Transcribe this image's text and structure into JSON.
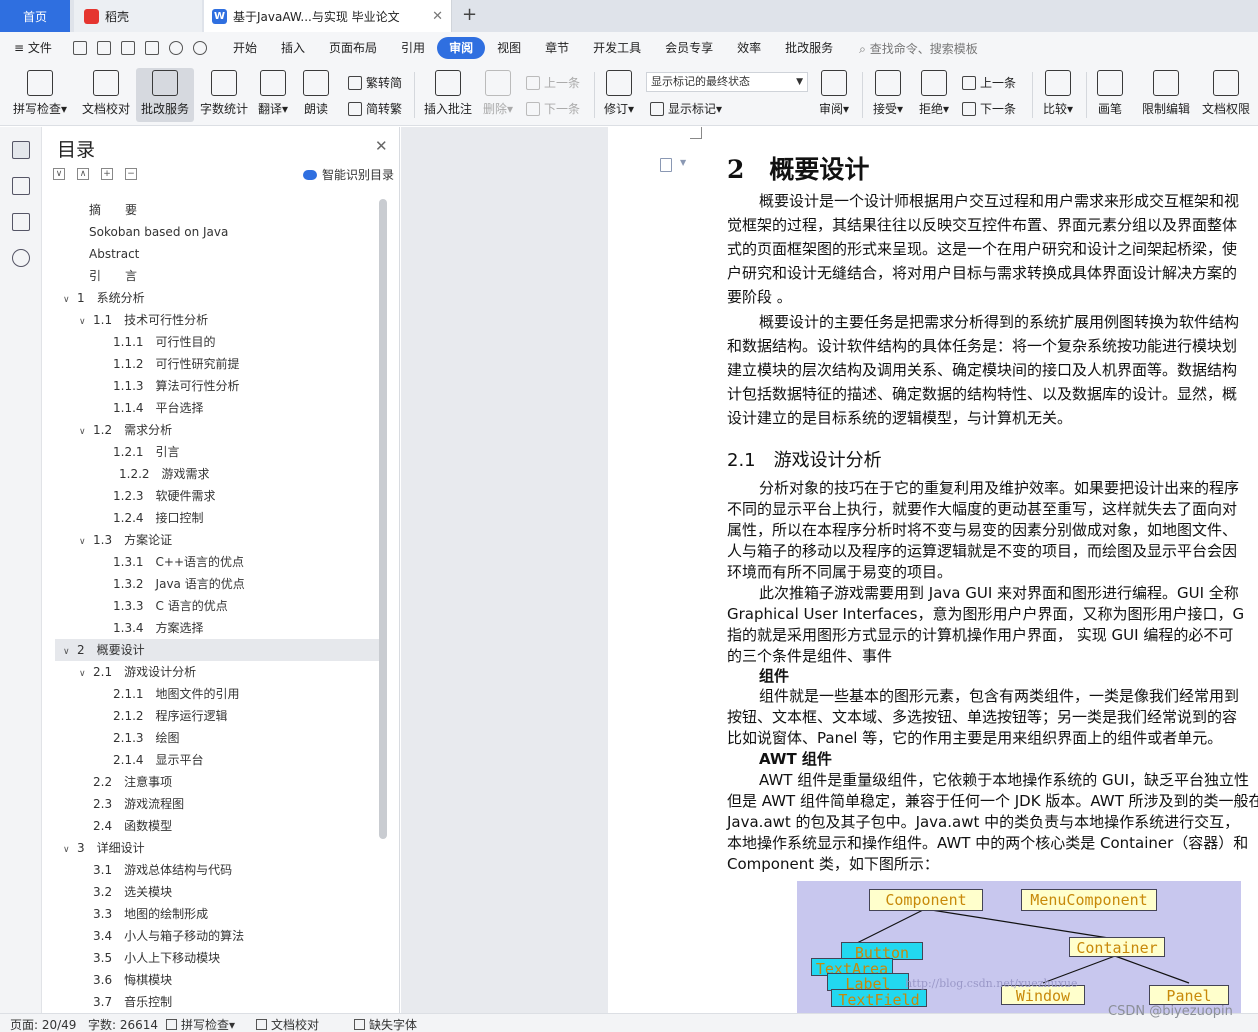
{
  "tabs": {
    "home": "首页",
    "daoke": "稻壳",
    "doc": "基于JavaAW...与实现 毕业论文",
    "doc_close": "✕",
    "add": "+"
  },
  "menu": {
    "file": "≡ 文件",
    "items": [
      "开始",
      "插入",
      "页面布局",
      "引用",
      "审阅",
      "视图",
      "章节",
      "开发工具",
      "会员专享",
      "效率",
      "批改服务"
    ],
    "active": "审阅",
    "search": "查找命令、搜索模板"
  },
  "ribbon": {
    "spell_check": "拼写检查",
    "doc_proof": "文档校对",
    "grading": "批改服务",
    "word_count": "字数统计",
    "translate": "翻译",
    "read_aloud": "朗读",
    "trad_to_simp": "繁转简",
    "simp_to_trad": "简转繁",
    "insert_comment": "插入批注",
    "delete": "删除",
    "prev1": "上一条",
    "next1": "下一条",
    "revise": "修订",
    "markup_select": "显示标记的最终状态",
    "show_markup": "显示标记",
    "review": "审阅",
    "accept": "接受",
    "reject": "拒绝",
    "prev2": "上一条",
    "next2": "下一条",
    "compare": "比较",
    "pen": "画笔",
    "restrict_edit": "限制编辑",
    "doc_permission": "文档权限"
  },
  "toc": {
    "title": "目录",
    "close": "✕",
    "smart": "智能识别目录",
    "items": [
      {
        "level": 0,
        "num": "",
        "text": "摘　　要",
        "arrow": ""
      },
      {
        "level": 0,
        "num": "",
        "text": "Sokoban based on Java",
        "arrow": ""
      },
      {
        "level": 0,
        "num": "",
        "text": "Abstract",
        "arrow": ""
      },
      {
        "level": 0,
        "num": "",
        "text": "引　　言",
        "arrow": ""
      },
      {
        "level": 0,
        "num": "1",
        "text": "系统分析",
        "arrow": "∨"
      },
      {
        "level": 1,
        "num": "1.1",
        "text": "技术可行性分析",
        "arrow": "∨"
      },
      {
        "level": 2,
        "num": "1.1.1",
        "text": "可行性目的",
        "arrow": ""
      },
      {
        "level": 2,
        "num": "1.1.2",
        "text": "可行性研究前提",
        "arrow": ""
      },
      {
        "level": 2,
        "num": "1.1.3",
        "text": "算法可行性分析",
        "arrow": ""
      },
      {
        "level": 2,
        "num": "1.1.4",
        "text": "平台选择",
        "arrow": ""
      },
      {
        "level": 1,
        "num": "1.2",
        "text": "需求分析",
        "arrow": "∨"
      },
      {
        "level": 2,
        "num": "1.2.1",
        "text": "引言",
        "arrow": ""
      },
      {
        "level": 3,
        "num": "1.2.2",
        "text": "游戏需求",
        "arrow": ""
      },
      {
        "level": 2,
        "num": "1.2.3",
        "text": "软硬件需求",
        "arrow": ""
      },
      {
        "level": 2,
        "num": "1.2.4",
        "text": "接口控制",
        "arrow": ""
      },
      {
        "level": 1,
        "num": "1.3",
        "text": "方案论证",
        "arrow": "∨"
      },
      {
        "level": 2,
        "num": "1.3.1",
        "text": "C++语言的优点",
        "arrow": ""
      },
      {
        "level": 2,
        "num": "1.3.2",
        "text": "Java 语言的优点",
        "arrow": ""
      },
      {
        "level": 2,
        "num": "1.3.3",
        "text": "C 语言的优点",
        "arrow": ""
      },
      {
        "level": 2,
        "num": "1.3.4",
        "text": "方案选择",
        "arrow": ""
      },
      {
        "level": 0,
        "num": "2",
        "text": "概要设计",
        "arrow": "∨"
      },
      {
        "level": 1,
        "num": "2.1",
        "text": "游戏设计分析",
        "arrow": "∨"
      },
      {
        "level": 2,
        "num": "2.1.1",
        "text": "地图文件的引用",
        "arrow": ""
      },
      {
        "level": 2,
        "num": "2.1.2",
        "text": "程序运行逻辑",
        "arrow": ""
      },
      {
        "level": 2,
        "num": "2.1.3",
        "text": "绘图",
        "arrow": ""
      },
      {
        "level": 2,
        "num": "2.1.4",
        "text": "显示平台",
        "arrow": ""
      },
      {
        "level": 1,
        "num": "2.2",
        "text": "注意事项",
        "arrow": ""
      },
      {
        "level": 1,
        "num": "2.3",
        "text": "游戏流程图",
        "arrow": ""
      },
      {
        "level": 1,
        "num": "2.4",
        "text": "函数模型",
        "arrow": ""
      },
      {
        "level": 0,
        "num": "3",
        "text": "详细设计",
        "arrow": "∨"
      },
      {
        "level": 1,
        "num": "3.1",
        "text": "游戏总体结构与代码",
        "arrow": ""
      },
      {
        "level": 1,
        "num": "3.2",
        "text": "选关模块",
        "arrow": ""
      },
      {
        "level": 1,
        "num": "3.3",
        "text": "地图的绘制形成",
        "arrow": ""
      },
      {
        "level": 1,
        "num": "3.4",
        "text": "小人与箱子移动的算法",
        "arrow": ""
      },
      {
        "level": 1,
        "num": "3.5",
        "text": "小人上下移动模块",
        "arrow": ""
      },
      {
        "level": 1,
        "num": "3.6",
        "text": "悔棋模块",
        "arrow": ""
      },
      {
        "level": 1,
        "num": "3.7",
        "text": "音乐控制",
        "arrow": ""
      }
    ],
    "active_index": 20
  },
  "document": {
    "heading1": "2　概要设计",
    "para1": [
      "概要设计是一个设计师根据用户交互过程和用户需求来形成交互框架和视",
      "觉框架的过程，其结果往往以反映交互控件布置、界面元素分组以及界面整体",
      "式的页面框架图的形式来呈现。这是一个在用户研究和设计之间架起桥梁，使",
      "户研究和设计无缝结合，将对用户目标与需求转换成具体界面设计解决方案的",
      "要阶段 。"
    ],
    "para2": [
      "概要设计的主要任务是把需求分析得到的系统扩展用例图转换为软件结构",
      "和数据结构。设计软件结构的具体任务是：将一个复杂系统按功能进行模块划",
      "建立模块的层次结构及调用关系、确定模块间的接口及人机界面等。数据结构",
      "计包括数据特征的描述、确定数据的结构特性、以及数据库的设计。显然，概",
      "设计建立的是目标系统的逻辑模型，与计算机无关。"
    ],
    "heading2": "2.1　游戏设计分析",
    "para3": [
      "分析对象的技巧在于它的重复利用及维护效率。如果要把设计出来的程序",
      "不同的显示平台上执行，就要作大幅度的更动甚至重写，这样就失去了面向对",
      "属性，所以在本程序分析时将不变与易变的因素分别做成对象，如地图文件、",
      "人与箱子的移动以及程序的运算逻辑就是不变的项目，而绘图及显示平台会因",
      "环境而有所不同属于易变的项目。"
    ],
    "para4": [
      "此次推箱子游戏需要用到 Java GUI 来对界面和图形进行编程。GUI 全称",
      "Graphical User Interfaces，意为图形用户户界面，又称为图形用户接口，G",
      "指的就是采用图形方式显示的计算机操作用户界面， 实现 GUI 编程的必不可",
      "的三个条件是组件、事件"
    ],
    "sub1": "组件",
    "para5": [
      "组件就是一些基本的图形元素，包含有两类组件，一类是像我们经常用到",
      "按钮、文本框、文本域、多选按钮、单选按钮等；另一类是我们经常说到的容",
      "比如说窗体、Panel 等，它的作用主要是用来组织界面上的组件或者单元。"
    ],
    "sub2": "AWT 组件",
    "para6": [
      "AWT 组件是重量级组件，它依赖于本地操作系统的 GUI，缺乏平台独立性",
      "但是 AWT 组件简单稳定，兼容于任何一个 JDK 版本。AWT 所涉及到的类一般在",
      "Java.awt 的包及其子包中。Java.awt 中的类负责与本地操作系统进行交互，",
      "本地操作系统显示和操作组件。AWT 中的两个核心类是 Container（容器）和",
      "Component 类，如下图所示："
    ]
  },
  "figure": {
    "component": "Component",
    "menucomponent": "MenuComponent",
    "container": "Container",
    "button": "Button",
    "label": "Label",
    "textarea": "TextArea",
    "textfield": "TextField",
    "window": "Window",
    "panel": "Panel",
    "watermark": "http://blog.csdn.net/xuezhuxue"
  },
  "status": {
    "page": "页面: 20/49",
    "words": "字数: 26614",
    "spell": "拼写检查",
    "proof": "文档校对",
    "missing_font": "缺失字体"
  },
  "watermark": "CSDN @biyezuopin"
}
